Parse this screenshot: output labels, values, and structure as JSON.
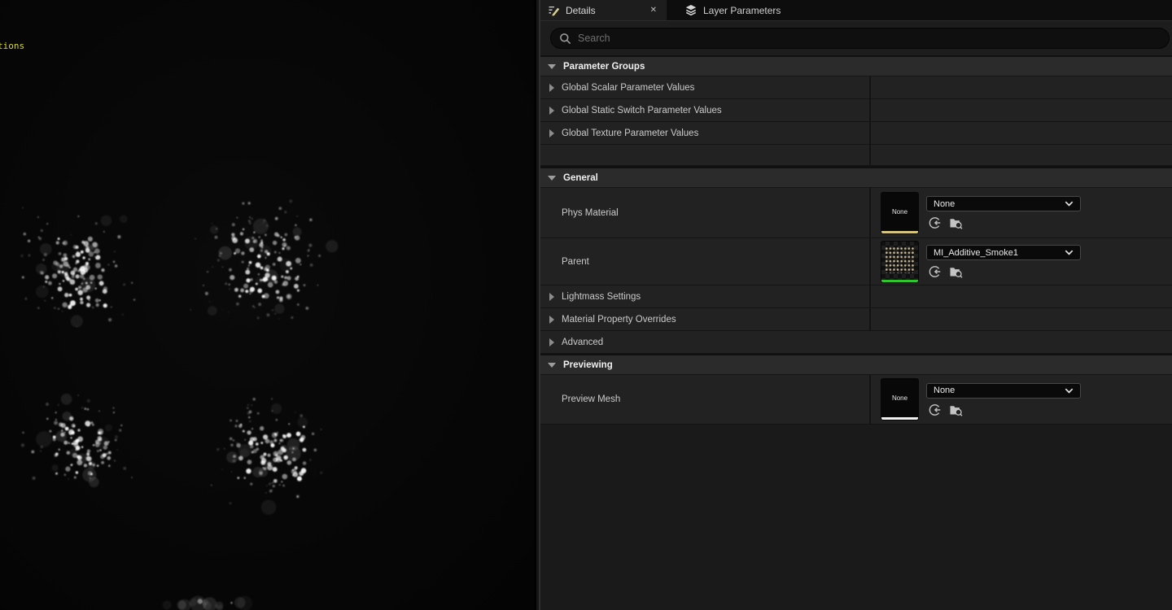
{
  "viewport": {
    "overlay_text": "tions"
  },
  "panel": {
    "tabs": {
      "details": "Details",
      "close_glyph": "✕",
      "layer_parameters": "Layer Parameters"
    },
    "search": {
      "placeholder": "Search"
    },
    "parameter_groups": {
      "title": "Parameter Groups",
      "rows": [
        "Global Scalar Parameter Values",
        "Global Static Switch Parameter Values",
        "Global Texture Parameter Values"
      ]
    },
    "general": {
      "title": "General",
      "phys_material": {
        "label": "Phys Material",
        "thumbnail_text": "None",
        "value": "None",
        "type_color": "#d6c57c"
      },
      "parent": {
        "label": "Parent",
        "value": "MI_Additive_Smoke1",
        "type_color": "#2ec82e"
      },
      "lightmass": "Lightmass Settings",
      "material_property_overrides": "Material Property Overrides",
      "advanced": "Advanced"
    },
    "previewing": {
      "title": "Previewing",
      "preview_mesh": {
        "label": "Preview Mesh",
        "thumbnail_text": "None",
        "value": "None",
        "type_color": "#efefef"
      }
    }
  }
}
